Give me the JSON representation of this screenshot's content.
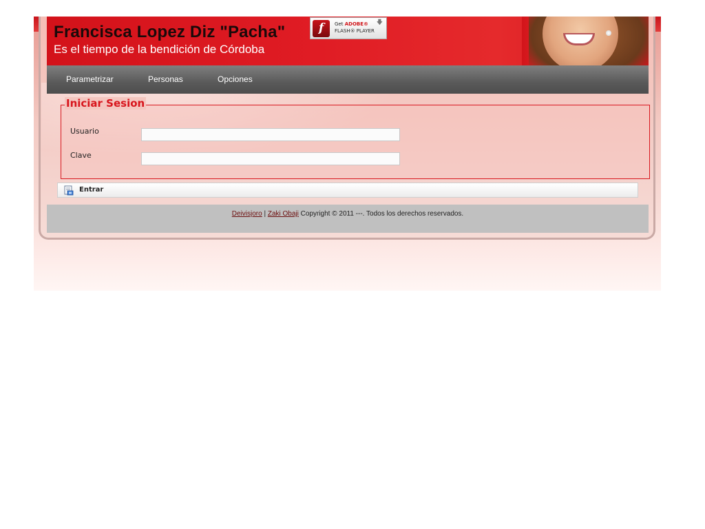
{
  "header": {
    "title": "Francisca Lopez Diz \"Pacha\"",
    "subtitle": "Es el tiempo de la bendición de Córdoba",
    "flash_badge": {
      "get": "Get",
      "adobe": "ADOBE®",
      "player": "FLASH® PLAYER",
      "icon": "flash-icon",
      "arrow": "download-arrow-icon"
    },
    "portrait": "woman-smiling-photo"
  },
  "nav": {
    "items": [
      {
        "label": "Parametrizar"
      },
      {
        "label": "Personas"
      },
      {
        "label": "Opciones"
      }
    ]
  },
  "login": {
    "legend": "Iniciar Sesion",
    "username_label": "Usuario",
    "username_value": "",
    "password_label": "Clave",
    "password_value": "",
    "submit_label": "Entrar",
    "submit_icon": "login-icon"
  },
  "footer": {
    "link1": "Deivisjoro",
    "separator": "|",
    "link2": "Zaki Obaji",
    "text": "Copyright © 2011 ---. Todos los derechos reservados."
  },
  "colors": {
    "accent_red": "#d8151c",
    "nav_gray": "#5a5a5a",
    "footer_gray": "#c0c0c0"
  }
}
